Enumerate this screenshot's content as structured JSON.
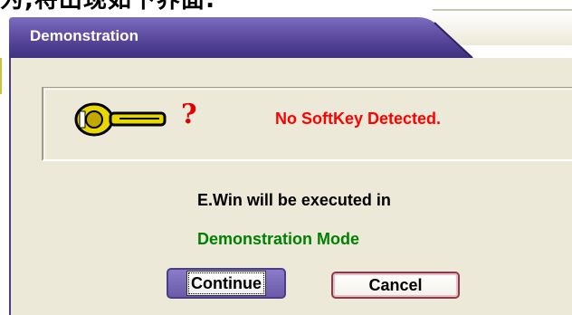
{
  "page_caption": "为,将出现如下界面:",
  "dialog": {
    "title": "Demonstration",
    "panel": {
      "key_icon": "key-icon",
      "question_icon": "?",
      "message": "No SoftKey Detected.",
      "message_color": "#ff0000"
    },
    "info_line": "E.Win will be executed in",
    "mode_line": "Demonstration Mode",
    "mode_color": "#008000",
    "buttons": {
      "continue_label": "Continue",
      "cancel_label": "Cancel"
    },
    "accent_color": "#5a4b96"
  }
}
